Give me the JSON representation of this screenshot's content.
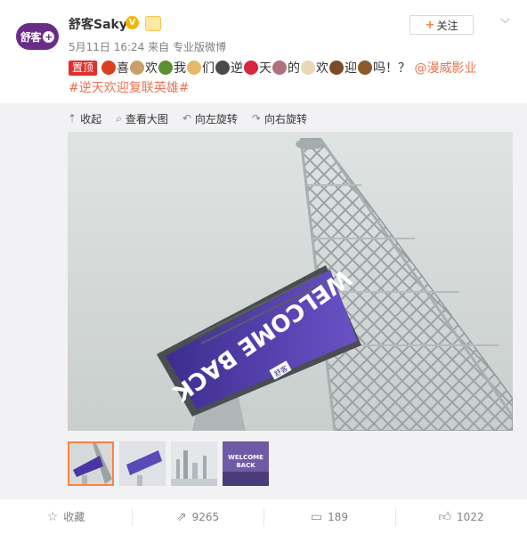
{
  "author": {
    "avatar_text": "舒客",
    "name": "舒客Saky",
    "verified": "V"
  },
  "meta": {
    "date": "5月11日 16:24",
    "source_prefix": "来自",
    "source": "专业版微博"
  },
  "follow_label": "关注",
  "post": {
    "pin_label": "置顶",
    "chars": [
      "喜",
      "欢",
      "我",
      "们",
      "逆",
      "天",
      "的",
      "欢",
      "迎",
      "吗！？"
    ],
    "mention": "@漫威影业",
    "hashtag": "#逆天欢迎复联英雄#"
  },
  "toolbar": {
    "collapse": "收起",
    "view_large": "查看大图",
    "rotate_left": "向左旋转",
    "rotate_right": "向右旋转"
  },
  "image": {
    "billboard_text": "WELCOME BACK",
    "billboard_logo": "舒客"
  },
  "thumbs": [
    {
      "label": ""
    },
    {
      "label": ""
    },
    {
      "label": ""
    },
    {
      "label": "WELCOME BACK"
    }
  ],
  "footer": {
    "favorite": "收藏",
    "repost": "9265",
    "comment": "189",
    "like": "1022"
  },
  "colors": {
    "accent": "#ff8140",
    "link": "#eb7350",
    "brand": "#6a2c86"
  }
}
